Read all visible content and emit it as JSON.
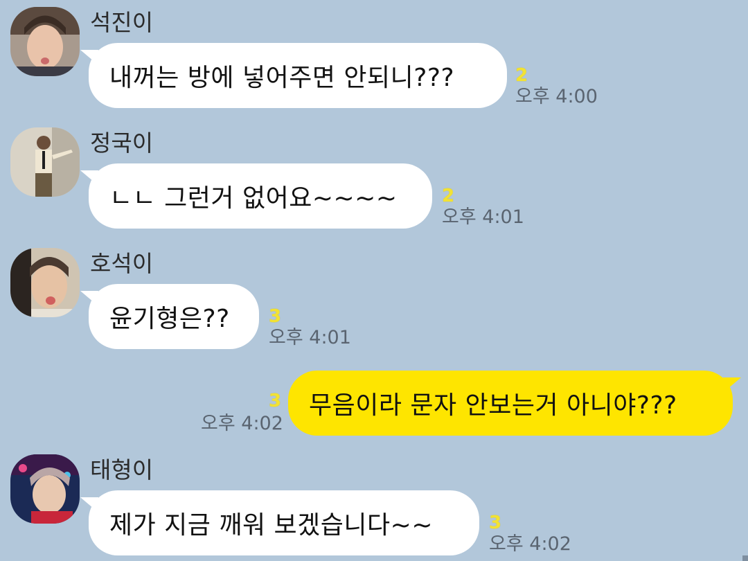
{
  "theme": {
    "background": "#b2c7da",
    "incoming_bubble": "#ffffff",
    "outgoing_bubble": "#fee500",
    "unread_color": "#f2e233",
    "time_color": "#5a6470"
  },
  "messages": [
    {
      "direction": "incoming",
      "sender": "석진이",
      "avatar": "profile-photo",
      "text": "내꺼는 방에 넣어주면 안되니???",
      "unread": "2",
      "time": "오후 4:00"
    },
    {
      "direction": "incoming",
      "sender": "정국이",
      "avatar": "profile-photo",
      "text": "ㄴㄴ 그런거 없어요~~~~",
      "unread": "2",
      "time": "오후 4:01"
    },
    {
      "direction": "incoming",
      "sender": "호석이",
      "avatar": "profile-photo",
      "text": "윤기형은??",
      "unread": "3",
      "time": "오후 4:01"
    },
    {
      "direction": "outgoing",
      "text": "무음이라 문자 안보는거 아니야???",
      "unread": "3",
      "time": "오후 4:02"
    },
    {
      "direction": "incoming",
      "sender": "태형이",
      "avatar": "profile-photo",
      "text": "제가 지금 깨워 보겠습니다~~",
      "unread": "3",
      "time": "오후 4:02"
    }
  ]
}
